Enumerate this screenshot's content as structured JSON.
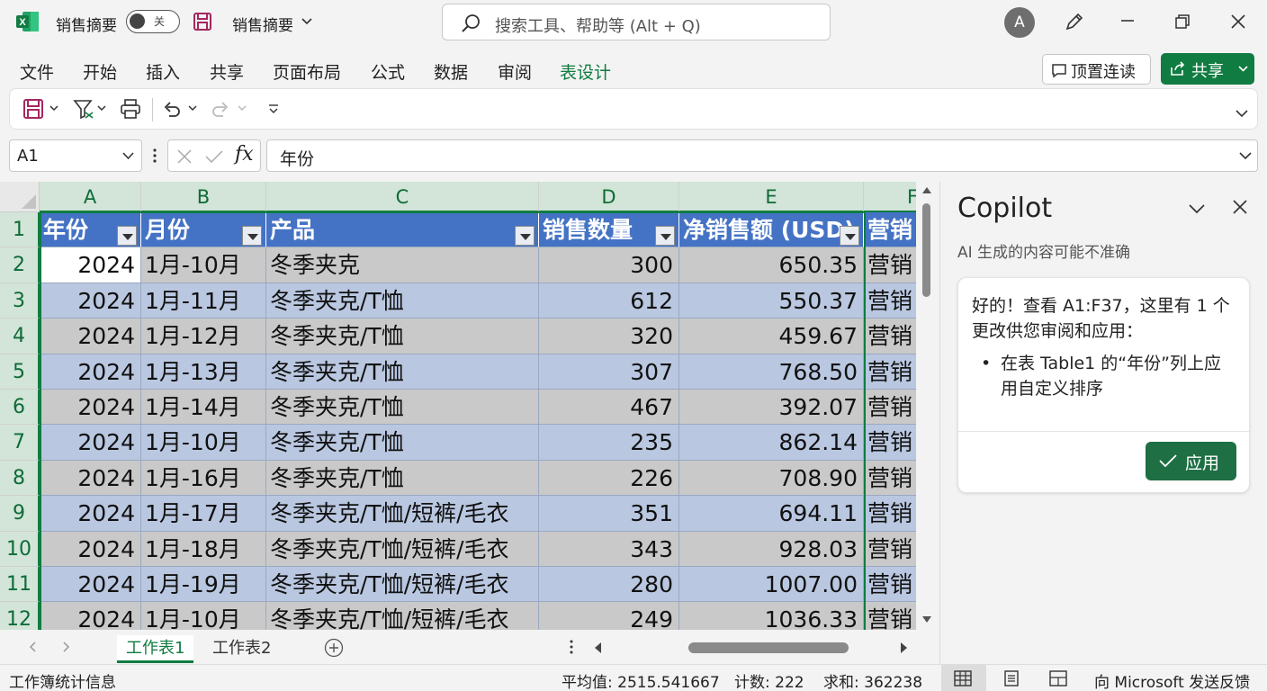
{
  "titlebar": {
    "app_title": "销售摘要",
    "autosave_label": "关",
    "doc_title": "销售摘要",
    "search_placeholder": "搜索工具、帮助等 (Alt + Q)",
    "avatar_initial": "A"
  },
  "ribbon": {
    "tabs": [
      {
        "label": "文件"
      },
      {
        "label": "开始"
      },
      {
        "label": "插入"
      },
      {
        "label": "共享"
      },
      {
        "label": "页面布局"
      },
      {
        "label": "公式"
      },
      {
        "label": "数据"
      },
      {
        "label": "审阅"
      },
      {
        "label": "表设计",
        "active": true
      }
    ],
    "read_button": "顶置连读",
    "share_button": "共享"
  },
  "formula_bar": {
    "name_box": "A1",
    "formula": "年份"
  },
  "grid": {
    "columns": [
      "A",
      "B",
      "C",
      "D",
      "E",
      "F"
    ],
    "headers": [
      "年份",
      "月份",
      "产品",
      "销售数量",
      "净销售额 (USD)",
      "营销"
    ],
    "row_numbers": [
      "1",
      "2",
      "3",
      "4",
      "5",
      "6",
      "7",
      "8",
      "9",
      "10",
      "11",
      "12"
    ],
    "rows": [
      [
        "2024",
        "1月-10月",
        "冬季夹克",
        "300",
        "650.35",
        "营销"
      ],
      [
        "2024",
        "1月-11月",
        "冬季夹克/T恤",
        "612",
        "550.37",
        "营销"
      ],
      [
        "2024",
        "1月-12月",
        "冬季夹克/T恤",
        "320",
        "459.67",
        "营销"
      ],
      [
        "2024",
        "1月-13月",
        "冬季夹克/T恤",
        "307",
        "768.50",
        "营销"
      ],
      [
        "2024",
        "1月-14月",
        "冬季夹克/T恤",
        "467",
        "392.07",
        "营销"
      ],
      [
        "2024",
        "1月-10月",
        "冬季夹克/T恤",
        "235",
        "862.14",
        "营销"
      ],
      [
        "2024",
        "1月-16月",
        "冬季夹克/T恤",
        "226",
        "708.90",
        "营销"
      ],
      [
        "2024",
        "1月-17月",
        "冬季夹克/T恤/短裤/毛衣",
        "351",
        "694.11",
        "营销"
      ],
      [
        "2024",
        "1月-18月",
        "冬季夹克/T恤/短裤/毛衣",
        "343",
        "928.03",
        "营销"
      ],
      [
        "2024",
        "1月-19月",
        "冬季夹克/T恤/短裤/毛衣",
        "280",
        "1007.00",
        "营销"
      ],
      [
        "2024",
        "1月-10月",
        "冬季夹克/T恤/短裤/毛衣",
        "249",
        "1036.33",
        "营销"
      ]
    ]
  },
  "sheets": {
    "tabs": [
      "工作表1",
      "工作表2"
    ],
    "active": "工作表1"
  },
  "copilot": {
    "title": "Copilot",
    "disclaimer": "AI 生成的内容可能不准确",
    "message": "好的！查看 A1:F37，这里有 1 个更改供您审阅和应用：",
    "bullet": "在表 Table1 的“年份”列上应用自定义排序",
    "apply_button": "应用"
  },
  "status_bar": {
    "left": "工作簿统计信息",
    "average": "平均值: 2515.541667",
    "count": "计数: 222",
    "sum": "求和: 362238",
    "feedback": "向 Microsoft 发送反馈"
  },
  "colors": {
    "accent": "#107c41",
    "table_header": "#4472c4",
    "band_blue": "#b9c7e0",
    "band_gray": "#c9c9c9"
  },
  "icons": [
    "excel-logo-icon",
    "save-icon",
    "search-icon",
    "pen-icon",
    "minimize-icon",
    "restore-icon",
    "close-icon",
    "comment-icon",
    "share-icon",
    "print-icon",
    "undo-icon",
    "redo-icon",
    "filter-icon",
    "fx-icon",
    "chevron-down-icon",
    "add-sheet-icon",
    "normal-view-icon",
    "page-layout-view-icon",
    "page-break-view-icon"
  ]
}
